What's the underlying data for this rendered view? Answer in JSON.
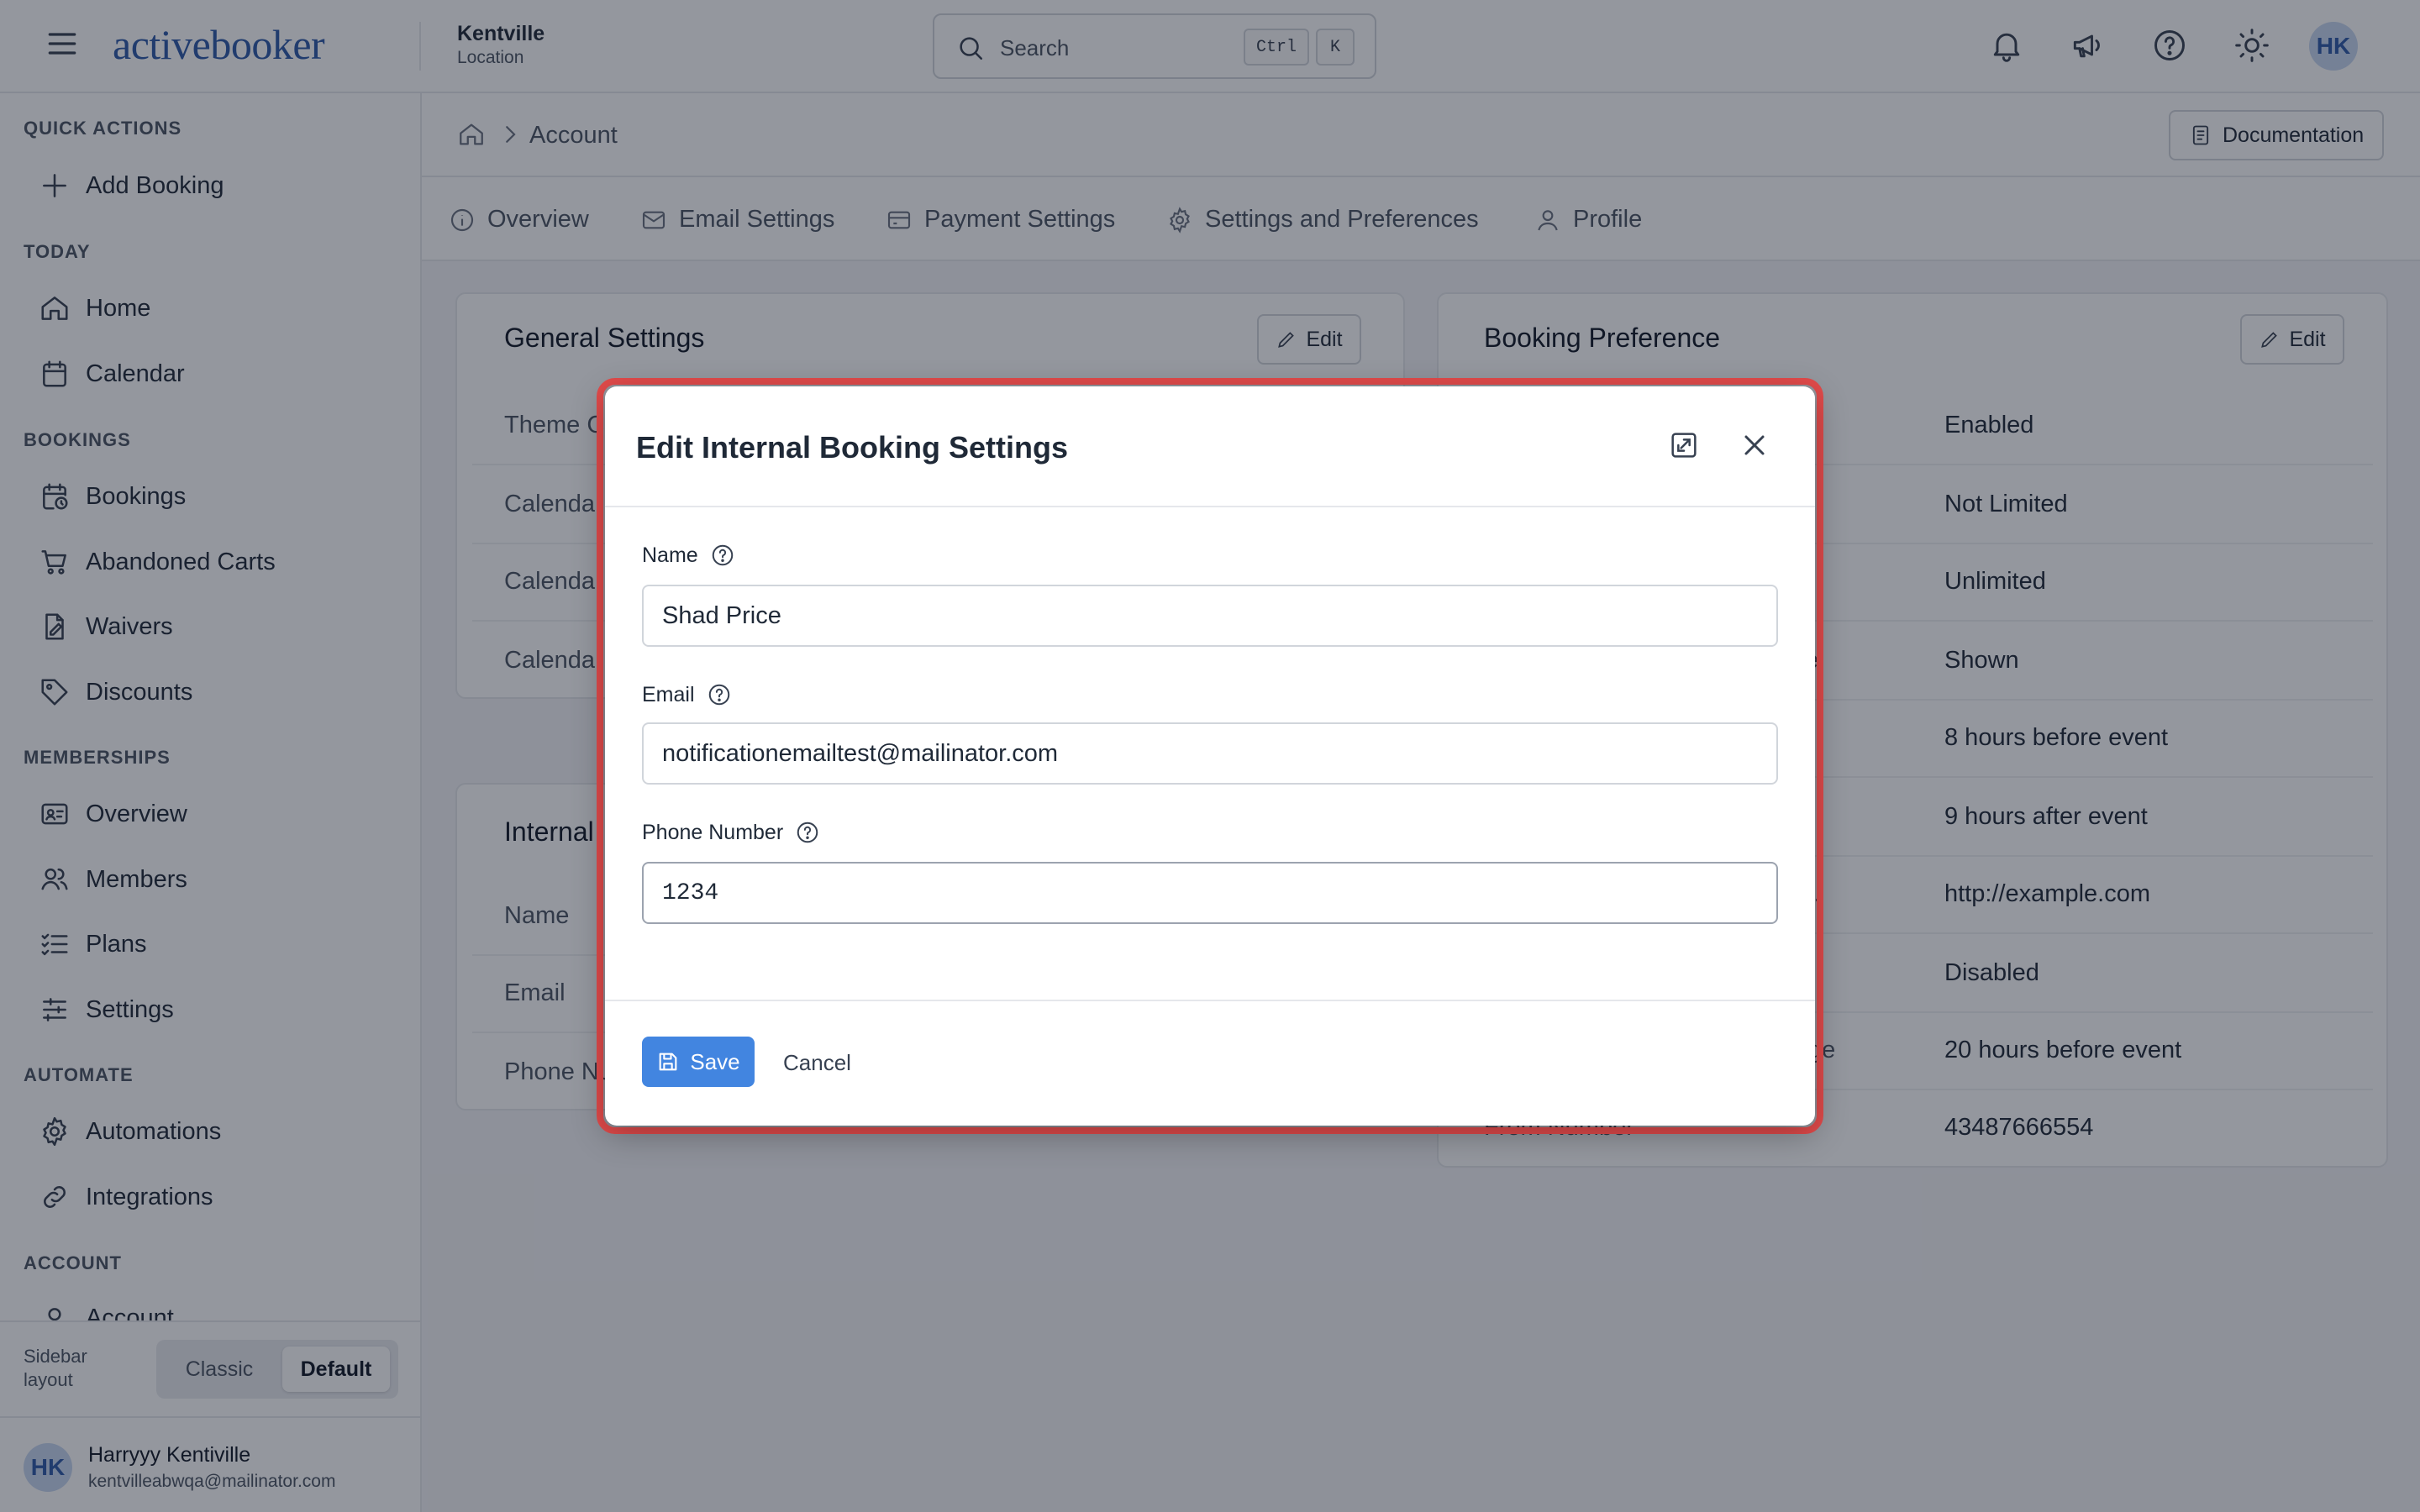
{
  "topbar": {
    "logo_text": "activebooker",
    "location_name": "Kentville",
    "location_sub": "Location",
    "search_placeholder": "Search",
    "shortcut_ctrl": "Ctrl",
    "shortcut_key": "K",
    "user_initials": "HK"
  },
  "sidebar": {
    "sections": {
      "quick_actions": "QUICK ACTIONS",
      "today": "TODAY",
      "bookings": "BOOKINGS",
      "memberships": "MEMBERSHIPS",
      "automate": "AUTOMATE",
      "account": "ACCOUNT"
    },
    "items": {
      "add_booking": "Add Booking",
      "home": "Home",
      "calendar": "Calendar",
      "bookings": "Bookings",
      "abandoned_carts": "Abandoned Carts",
      "waivers": "Waivers",
      "discounts": "Discounts",
      "overview": "Overview",
      "members": "Members",
      "plans": "Plans",
      "settings": "Settings",
      "automations": "Automations",
      "integrations": "Integrations",
      "account": "Account"
    },
    "layout_label": "Sidebar layout",
    "layout_classic": "Classic",
    "layout_default": "Default",
    "user_initials": "HK",
    "user_name": "Harryyy Kentiville",
    "user_email": "kentvilleabwqa@mailinator.com"
  },
  "breadcrumb": {
    "current": "Account",
    "documentation": "Documentation"
  },
  "tabs": {
    "overview": "Overview",
    "email_settings": "Email Settings",
    "payment_settings": "Payment Settings",
    "settings_preferences": "Settings and Preferences",
    "profile": "Profile"
  },
  "general_settings": {
    "title": "General Settings",
    "edit": "Edit",
    "rows": [
      "Theme C",
      "Calenda",
      "Calenda",
      "Calenda"
    ]
  },
  "internal_card": {
    "title": "Internal",
    "rows": [
      "Name",
      "Email",
      "Phone Nu"
    ]
  },
  "booking_preference": {
    "title": "Booking Preference",
    "edit": "Edit",
    "row_label_fragments": [
      "ge",
      "l.",
      "ge",
      "From Number"
    ],
    "values": [
      "Enabled",
      "Not Limited",
      "Unlimited",
      "Shown",
      "8 hours before event",
      "9 hours after event",
      "http://example.com",
      "Disabled",
      "20 hours before event",
      "43487666554"
    ]
  },
  "modal": {
    "title": "Edit Internal Booking Settings",
    "name_label": "Name",
    "name_value": "Shad Price",
    "email_label": "Email",
    "email_value": "notificationemailtest@mailinator.com",
    "phone_label": "Phone Number",
    "phone_value": "1234",
    "save": "Save",
    "cancel": "Cancel"
  },
  "colors": {
    "primary": "#4285e0",
    "brand": "#2e5aa8",
    "highlight": "#e24b4b"
  }
}
